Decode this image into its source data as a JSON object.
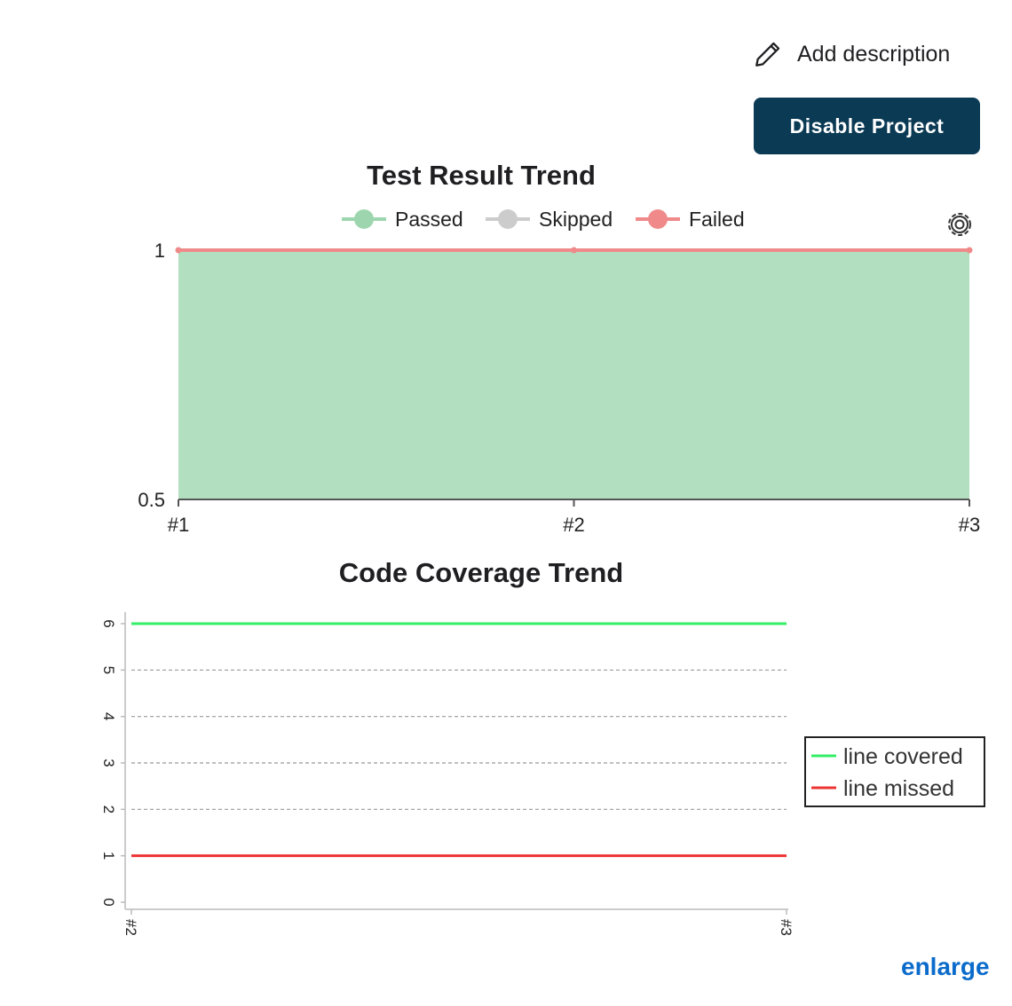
{
  "header": {
    "add_description_label": "Add description",
    "disable_project_label": "Disable Project"
  },
  "test_result_trend": {
    "title": "Test Result Trend",
    "legend": [
      {
        "name": "Passed",
        "color": "#9dd6ae"
      },
      {
        "name": "Skipped",
        "color": "#cccccc"
      },
      {
        "name": "Failed",
        "color": "#f08a8a"
      }
    ]
  },
  "code_coverage_trend": {
    "title": "Code Coverage Trend",
    "legend": [
      {
        "name": "line covered",
        "color": "#33ee66"
      },
      {
        "name": "line missed",
        "color": "#ee3333"
      }
    ]
  },
  "footer": {
    "enlarge_label": "enlarge"
  },
  "chart_data": [
    {
      "type": "area",
      "title": "Test Result Trend",
      "categories": [
        "#1",
        "#2",
        "#3"
      ],
      "y_ticks": [
        "1",
        "0.5"
      ],
      "ylim": [
        0.5,
        1
      ],
      "series": [
        {
          "name": "Passed",
          "values": [
            1,
            1,
            1
          ],
          "color": "#b2dfbf"
        },
        {
          "name": "Skipped",
          "values": [
            0,
            0,
            0
          ],
          "color": "#cccccc"
        },
        {
          "name": "Failed",
          "values": [
            0,
            0,
            0
          ],
          "color": "#f08a8a"
        }
      ],
      "legend_position": "top"
    },
    {
      "type": "line",
      "title": "Code Coverage Trend",
      "categories": [
        "#2",
        "#3"
      ],
      "y_ticks": [
        "0",
        "1",
        "2",
        "3",
        "4",
        "5",
        "6"
      ],
      "ylim": [
        0,
        6
      ],
      "grid": true,
      "series": [
        {
          "name": "line covered",
          "values": [
            6,
            6
          ],
          "color": "#33ee66"
        },
        {
          "name": "line missed",
          "values": [
            1,
            1
          ],
          "color": "#ee3333"
        }
      ],
      "legend_position": "right"
    }
  ]
}
